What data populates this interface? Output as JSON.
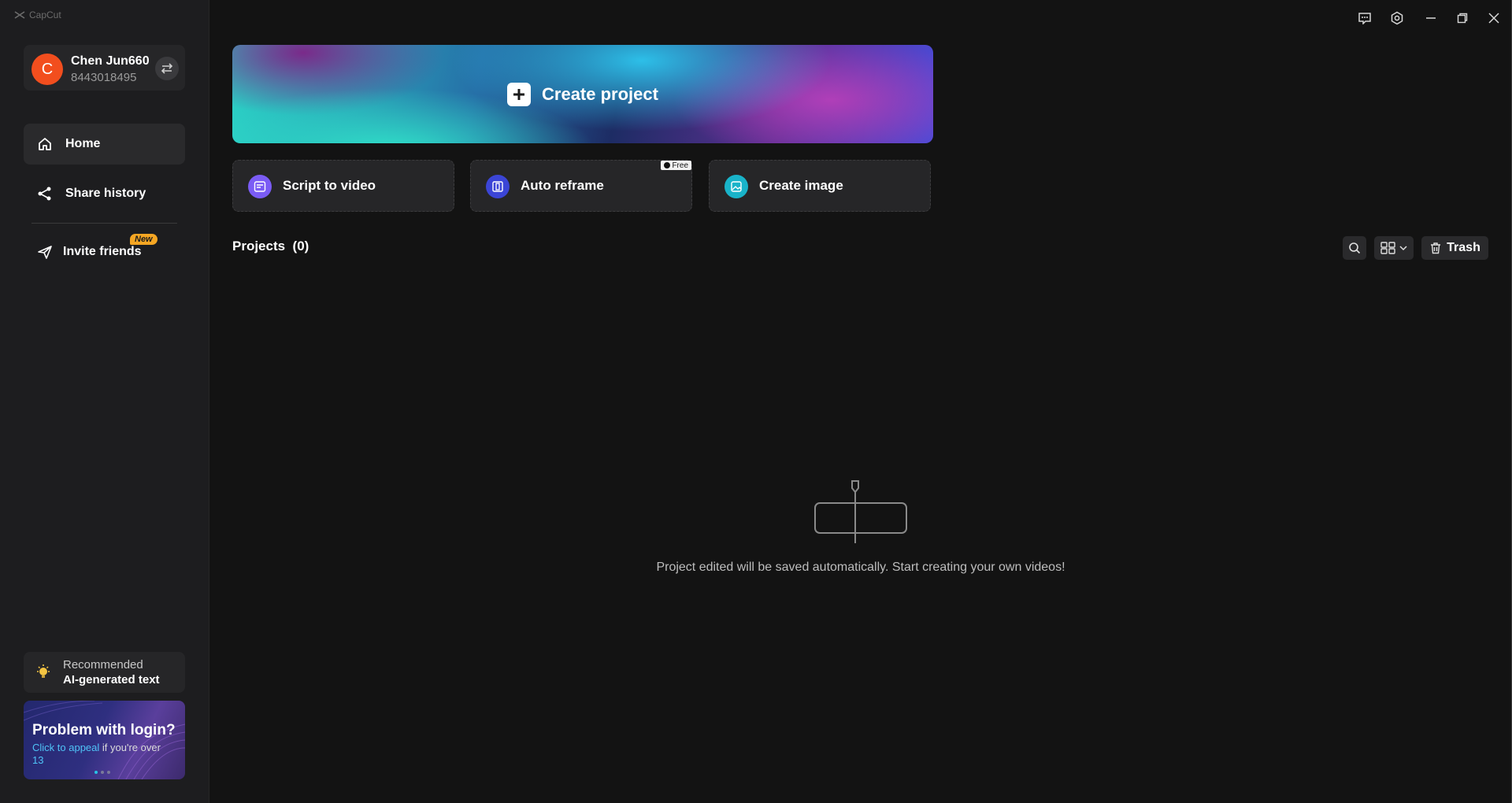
{
  "app": {
    "name": "CapCut"
  },
  "profile": {
    "avatar_letter": "C",
    "name": "Chen Jun660",
    "id": "8443018495"
  },
  "nav": {
    "home": "Home",
    "share_history": "Share history",
    "invite_friends": "Invite friends",
    "new_badge": "New"
  },
  "recommend": {
    "top": "Recommended",
    "bottom": "AI-generated text"
  },
  "banner": {
    "title": "Problem with login?",
    "link": "Click to appeal",
    "rest": " if you're over",
    "age": "13"
  },
  "hero": {
    "label": "Create project"
  },
  "tools": [
    {
      "label": "Script to video",
      "color": "#7b5cf5"
    },
    {
      "label": "Auto reframe",
      "color": "#3b45d6",
      "badge": "Free"
    },
    {
      "label": "Create image",
      "color": "#19b3c9"
    }
  ],
  "projects": {
    "title": "Projects",
    "count": "(0)",
    "trash": "Trash",
    "empty_text": "Project edited will be saved automatically. Start creating your own videos!"
  },
  "icons": {
    "window": [
      "feedback-icon",
      "settings-icon",
      "minimize-icon",
      "restore-icon",
      "close-icon"
    ],
    "nav": [
      "home-icon",
      "share-icon",
      "send-icon"
    ]
  },
  "colors": {
    "accent": "#28c4e6",
    "avatar": "#f24e1e",
    "badge": "#f5a623"
  }
}
